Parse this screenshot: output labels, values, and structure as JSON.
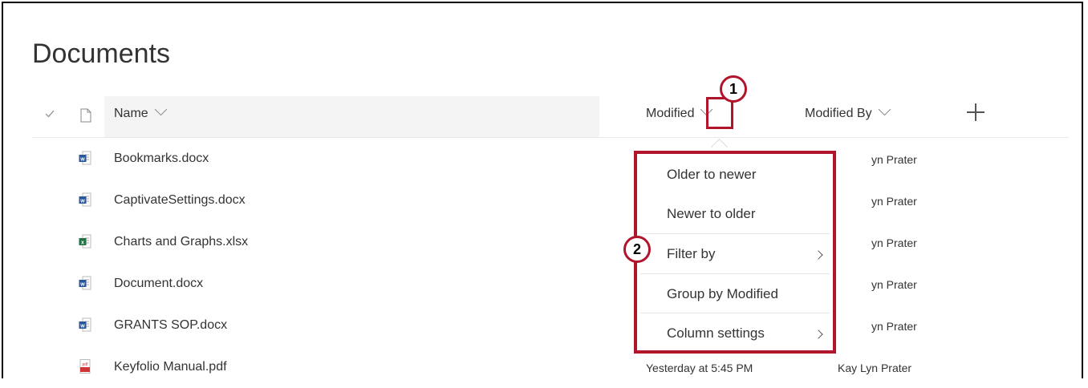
{
  "page": {
    "title": "Documents"
  },
  "columns": {
    "name": "Name",
    "modified": "Modified",
    "modified_by": "Modified By",
    "add_icon": "plus-icon",
    "check_icon": "checkmark-icon",
    "doc_icon": "document-icon"
  },
  "files": [
    {
      "name": "Bookmarks.docx",
      "type": "word",
      "modified": "",
      "modified_by": "yn Prater"
    },
    {
      "name": "CaptivateSettings.docx",
      "type": "word",
      "modified": "",
      "modified_by": "yn Prater"
    },
    {
      "name": "Charts and Graphs.xlsx",
      "type": "excel",
      "modified": "",
      "modified_by": "yn Prater"
    },
    {
      "name": "Document.docx",
      "type": "word",
      "modified": "",
      "modified_by": "yn Prater"
    },
    {
      "name": "GRANTS SOP.docx",
      "type": "word",
      "modified": "",
      "modified_by": "yn Prater"
    },
    {
      "name": "Keyfolio Manual.pdf",
      "type": "pdf",
      "modified": "Yesterday at 5:45 PM",
      "modified_by": "Kay Lyn Prater"
    }
  ],
  "menu": {
    "items": [
      {
        "label": "Older to newer",
        "submenu": false
      },
      {
        "label": "Newer to older",
        "submenu": false
      },
      {
        "label": "Filter by",
        "submenu": true
      },
      {
        "label": "Group by Modified",
        "submenu": false
      },
      {
        "label": "Column settings",
        "submenu": true
      }
    ]
  },
  "callouts": {
    "one": "1",
    "two": "2"
  },
  "colors": {
    "callout": "#b0152c",
    "word": "#2b579a",
    "excel": "#217346",
    "pdf": "#d13438"
  }
}
